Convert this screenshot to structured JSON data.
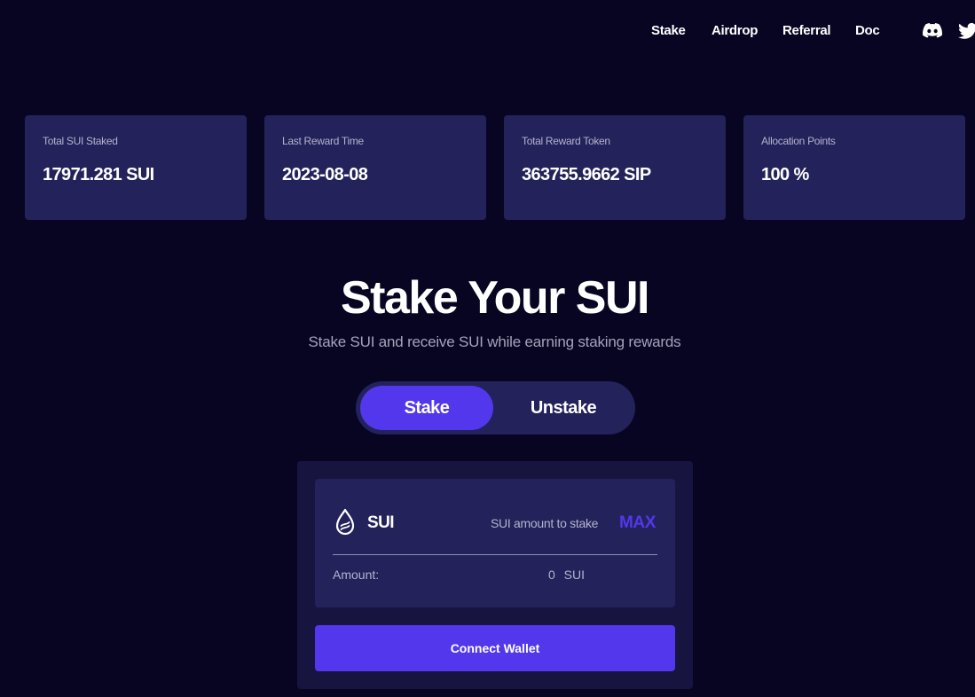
{
  "nav": {
    "links": [
      "Stake",
      "Airdrop",
      "Referral",
      "Doc"
    ],
    "social": [
      "discord-icon",
      "twitter-icon"
    ]
  },
  "stats": [
    {
      "label": "Total SUI Staked",
      "value": "17971.281 SUI"
    },
    {
      "label": "Last Reward Time",
      "value": "2023-08-08"
    },
    {
      "label": "Total Reward Token",
      "value": "363755.9662 SIP"
    },
    {
      "label": "Allocation Points",
      "value": "100 %"
    }
  ],
  "hero": {
    "title": "Stake Your SUI",
    "subtitle": "Stake SUI and receive SUI while earning staking rewards"
  },
  "toggle": {
    "options": [
      "Stake",
      "Unstake"
    ],
    "selected": "Stake"
  },
  "stake_panel": {
    "token": "SUI",
    "token_icon": "sui-drop-icon",
    "amount_hint": "SUI amount to stake",
    "max_label": "MAX",
    "amount_label": "Amount:",
    "amount_value": "0 SUI",
    "connect_label": "Connect Wallet"
  },
  "colors": {
    "background": "#080522",
    "card": "#23225a",
    "panel": "#17153f",
    "accent": "#5337ec",
    "muted_text": "#b4b3cf"
  }
}
